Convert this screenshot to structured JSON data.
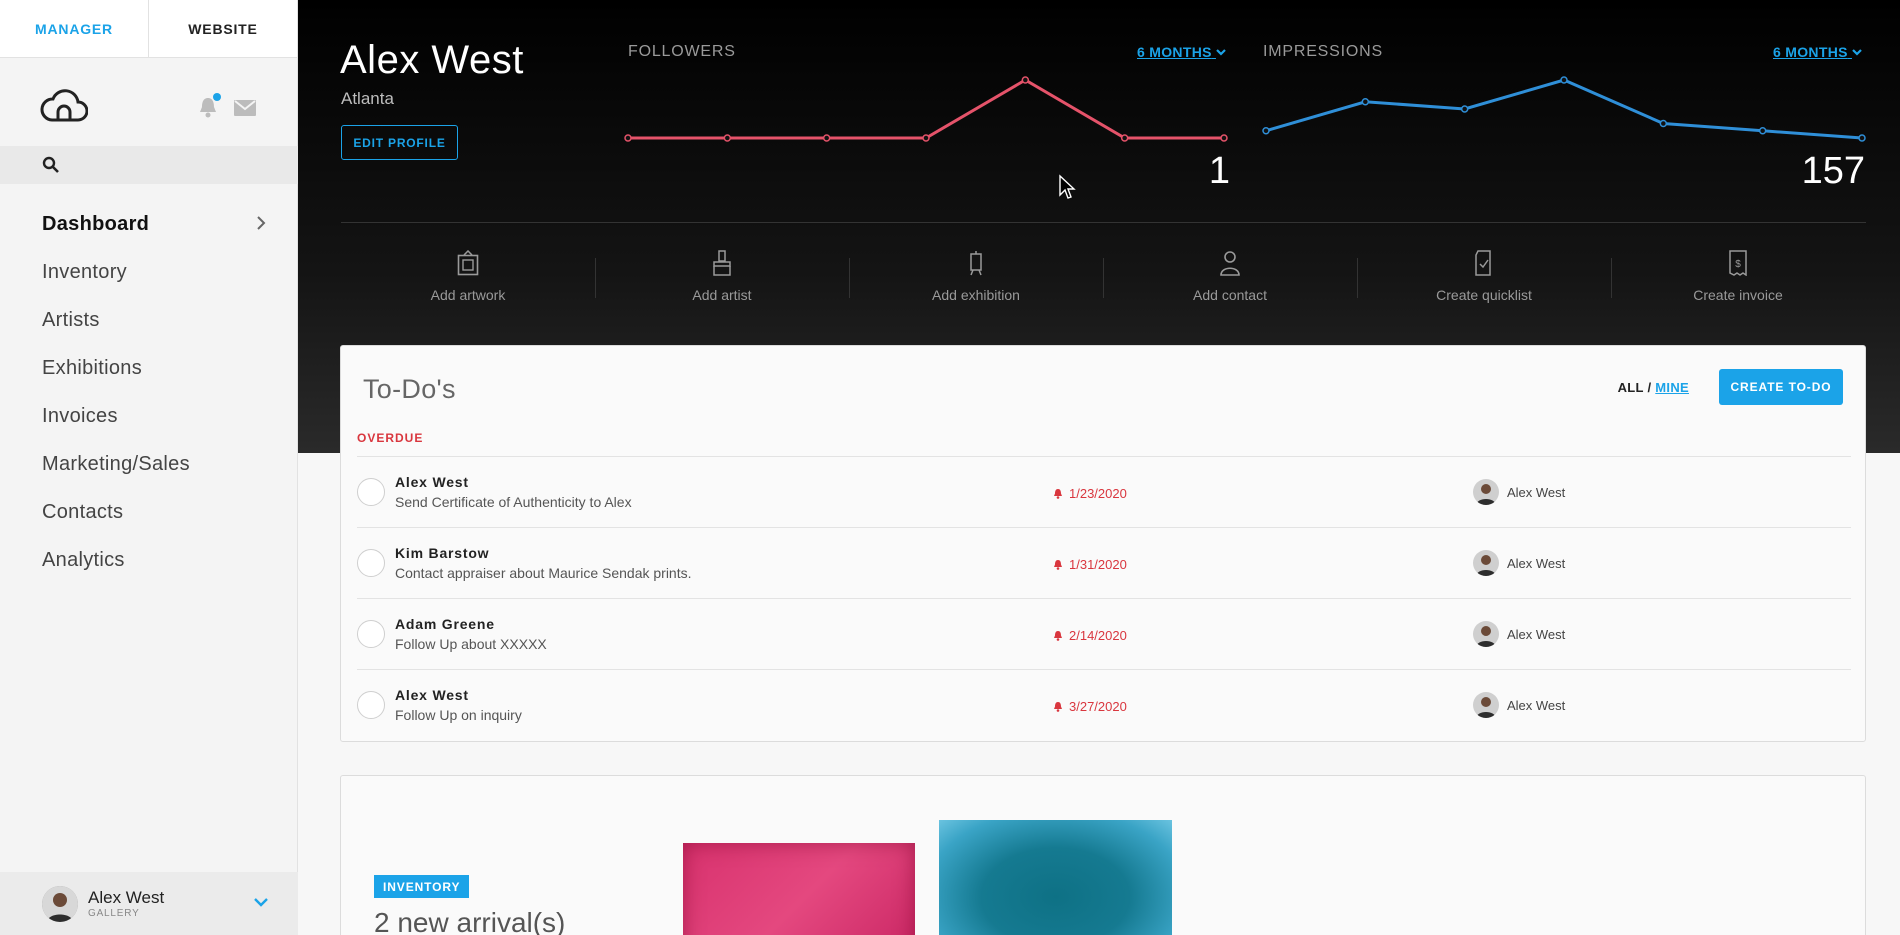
{
  "sidebar": {
    "tabs": [
      {
        "label": "MANAGER"
      },
      {
        "label": "WEBSITE"
      }
    ],
    "nav": [
      {
        "label": "Dashboard"
      },
      {
        "label": "Inventory"
      },
      {
        "label": "Artists"
      },
      {
        "label": "Exhibitions"
      },
      {
        "label": "Invoices"
      },
      {
        "label": "Marketing/Sales"
      },
      {
        "label": "Contacts"
      },
      {
        "label": "Analytics"
      }
    ],
    "user": {
      "name": "Alex West",
      "role": "GALLERY"
    }
  },
  "profile": {
    "name": "Alex West",
    "city": "Atlanta",
    "edit_label": "EDIT PROFILE"
  },
  "stats": {
    "followers": {
      "label": "FOLLOWERS",
      "range": "6 MONTHS",
      "value": "1",
      "points": [
        0,
        0,
        0,
        0,
        1,
        0,
        0
      ],
      "color": "#e5536a"
    },
    "impressions": {
      "label": "IMPRESSIONS",
      "range": "6 MONTHS",
      "value": "157",
      "points": [
        22,
        26,
        25,
        29,
        23,
        22,
        21
      ],
      "color": "#2f8fd8"
    }
  },
  "quick_actions": [
    {
      "label": "Add artwork",
      "icon": "frame-icon"
    },
    {
      "label": "Add artist",
      "icon": "brush-icon"
    },
    {
      "label": "Add exhibition",
      "icon": "easel-icon"
    },
    {
      "label": "Add contact",
      "icon": "person-icon"
    },
    {
      "label": "Create quicklist",
      "icon": "checklist-icon"
    },
    {
      "label": "Create invoice",
      "icon": "invoice-icon"
    }
  ],
  "todos": {
    "title": "To-Do's",
    "filter_all": "ALL",
    "filter_sep": "/",
    "filter_mine": "MINE",
    "create_label": "CREATE TO-DO",
    "section": "OVERDUE",
    "items": [
      {
        "who": "Alex West",
        "desc": "Send Certificate of Authenticity to Alex",
        "due": "1/23/2020",
        "assignee": "Alex West"
      },
      {
        "who": "Kim Barstow",
        "desc": "Contact appraiser about Maurice Sendak prints.",
        "due": "1/31/2020",
        "assignee": "Alex West"
      },
      {
        "who": "Adam Greene",
        "desc": "Follow Up about XXXXX",
        "due": "2/14/2020",
        "assignee": "Alex West"
      },
      {
        "who": "Alex West",
        "desc": "Follow Up on inquiry",
        "due": "3/27/2020",
        "assignee": "Alex West"
      }
    ]
  },
  "inventory": {
    "badge": "INVENTORY",
    "count_label": "2 new arrival(s)"
  },
  "colors": {
    "accent": "#1ba3e8",
    "overdue": "#d9363e"
  }
}
